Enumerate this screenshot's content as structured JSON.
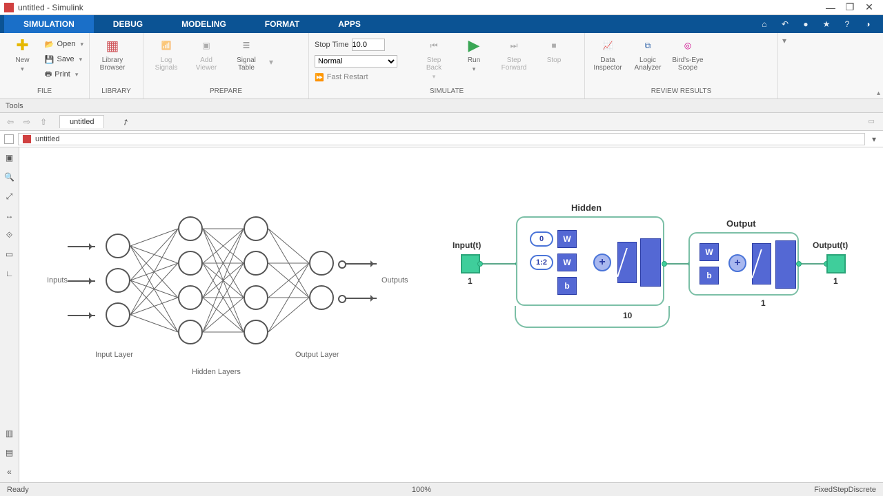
{
  "window": {
    "title": "untitled - Simulink",
    "min": "—",
    "restore": "❐",
    "close": "✕"
  },
  "ribbon_tabs": [
    "SIMULATION",
    "DEBUG",
    "MODELING",
    "FORMAT",
    "APPS"
  ],
  "ribbon_active": 0,
  "ribbon": {
    "file": {
      "new": "New",
      "open": "Open",
      "save": "Save",
      "print": "Print",
      "group": "FILE"
    },
    "library": {
      "browser": "Library\nBrowser",
      "group": "LIBRARY"
    },
    "prepare": {
      "log_signals": "Log\nSignals",
      "add_viewer": "Add\nViewer",
      "signal_table": "Signal\nTable",
      "group": "PREPARE"
    },
    "simulate": {
      "stop_time_label": "Stop Time",
      "stop_time_value": "10.0",
      "mode": "Normal",
      "fast_restart": "Fast Restart",
      "step_back": "Step\nBack",
      "run": "Run",
      "step_forward": "Step\nForward",
      "stop": "Stop",
      "group": "SIMULATE"
    },
    "review": {
      "data_inspector": "Data\nInspector",
      "logic_analyzer": "Logic\nAnalyzer",
      "birdseye": "Bird's-Eye\nScope",
      "group": "REVIEW RESULTS"
    }
  },
  "tools_label": "Tools",
  "doc_tab": "untitled",
  "breadcrumb": "untitled",
  "nn_labels": {
    "inputs": "Inputs",
    "input_layer": "Input Layer",
    "hidden_layers": "Hidden Layers",
    "output_layer": "Output Layer",
    "outputs": "Outputs"
  },
  "slk": {
    "input_label": "Input(t)",
    "input_size": "1",
    "hidden_label": "Hidden",
    "hidden_size": "10",
    "output_label": "Output",
    "output_size": "1",
    "out_port_label": "Output(t)",
    "out_port_size": "1",
    "delay0": "0",
    "delay12": "1:2",
    "W": "W",
    "b": "b",
    "plus": "+"
  },
  "status": {
    "ready": "Ready",
    "zoom": "100%",
    "solver": "FixedStepDiscrete"
  }
}
